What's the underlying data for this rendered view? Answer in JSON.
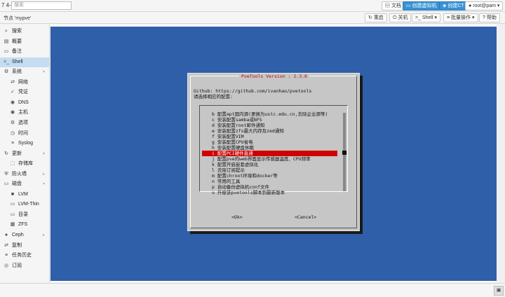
{
  "topbar": {
    "version": "7 4-3",
    "search_placeholder": "搜索",
    "docs": "文档",
    "create_vm": "创建虚拟机",
    "create_ct": "创建CT",
    "user": "root@pam"
  },
  "subbar": {
    "node_title": "节点 'mypve'",
    "restart": "重启",
    "shutdown": "关机",
    "shell": "Shell",
    "bulk": "批量操作",
    "help": "帮助"
  },
  "sidebar": {
    "items": [
      {
        "label": "搜索",
        "icon": "⌕"
      },
      {
        "label": "概要",
        "icon": "▤"
      },
      {
        "label": "备注",
        "icon": "▭"
      },
      {
        "label": "Shell",
        "icon": ">_"
      },
      {
        "label": "系统",
        "icon": "⚙"
      },
      {
        "label": "网络",
        "icon": "⇄"
      },
      {
        "label": "凭证",
        "icon": "✓"
      },
      {
        "label": "DNS",
        "icon": "◉"
      },
      {
        "label": "主机",
        "icon": "◉"
      },
      {
        "label": "选项",
        "icon": "⚙"
      },
      {
        "label": "时间",
        "icon": "◷"
      },
      {
        "label": "Syslog",
        "icon": "≡"
      },
      {
        "label": "更新",
        "icon": "↻"
      },
      {
        "label": "存储库",
        "icon": "⬚"
      },
      {
        "label": "防火墙",
        "icon": "⛨"
      },
      {
        "label": "磁盘",
        "icon": "▭"
      },
      {
        "label": "LVM",
        "icon": "■"
      },
      {
        "label": "LVM-Thin",
        "icon": "▭"
      },
      {
        "label": "目录",
        "icon": "▭"
      },
      {
        "label": "ZFS",
        "icon": "▦"
      },
      {
        "label": "Ceph",
        "icon": "●"
      },
      {
        "label": "复制",
        "icon": "⇄"
      },
      {
        "label": "任务历史",
        "icon": "≡"
      },
      {
        "label": "订阅",
        "icon": "◎"
      }
    ]
  },
  "dialog": {
    "title": "PveTools   Version : 2.3.6",
    "github": "Github: https://github.com/ivanhao/pvetools",
    "prompt": "请选择相应的配置:",
    "items": [
      {
        "key": "b",
        "text": "配置apt国内源(更换为ustc.edu.cn,去除企业源等)"
      },
      {
        "key": "c",
        "text": "安装配置samba或NFS"
      },
      {
        "key": "d",
        "text": "安装配置root邮件通知"
      },
      {
        "key": "e",
        "text": "安装配置zfs最大内存及zed通知"
      },
      {
        "key": "f",
        "text": "安装配置VIM"
      },
      {
        "key": "g",
        "text": "安装配置CPU省电"
      },
      {
        "key": "h",
        "text": "安装配置硬盘休眠"
      },
      {
        "key": "i",
        "text": "配置PCI硬件直通"
      },
      {
        "key": "j",
        "text": "配置pve的web界面显示传感器温度、CPU频率"
      },
      {
        "key": "k",
        "text": "配置开启嵌套虚拟化"
      },
      {
        "key": "l",
        "text": "去除订阅提示"
      },
      {
        "key": "m",
        "text": "配置chroot环境和docker等"
      },
      {
        "key": "n",
        "text": "常用的工具"
      },
      {
        "key": "p",
        "text": "自动备份虚拟机conf文件"
      },
      {
        "key": "u",
        "text": "升级该pvetools脚本到最新版本"
      }
    ],
    "ok": "<Ok>",
    "cancel": "<Cancel>"
  }
}
